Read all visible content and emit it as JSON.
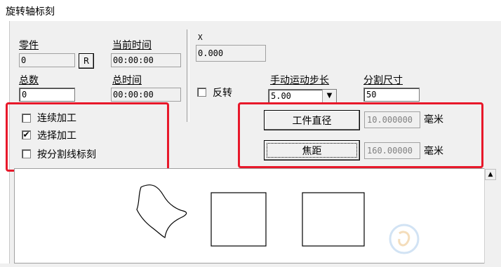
{
  "window": {
    "title": "旋转轴标刻"
  },
  "counters": {
    "part_label": "零件",
    "part_value": "0",
    "reset_label": "R",
    "current_time_label": "当前时间",
    "current_time_value": "00:00:00",
    "total_label": "总数",
    "total_value": "0",
    "total_time_label": "总时间",
    "total_time_value": "00:00:00"
  },
  "axis": {
    "x_label": "X",
    "x_value": "0.000",
    "reverse_label": "反转",
    "reverse_checked": false,
    "step_label": "手动运动步长",
    "step_value": "5.00",
    "split_label": "分割尺寸",
    "split_value": "50"
  },
  "mode": {
    "continuous_label": "连续加工",
    "continuous_checked": false,
    "select_label": "选择加工",
    "select_checked": true,
    "split_mark_label": "按分割线标刻",
    "split_mark_checked": false
  },
  "dims": {
    "diameter_button": "工件直径",
    "diameter_value": "10.000000",
    "diameter_unit": "毫米",
    "focus_button": "焦距",
    "focus_value": "160.00000",
    "focus_unit": "毫米"
  },
  "highlight_color": "#e8182a",
  "preview": {
    "shapes": [
      "freeform-curve",
      "square",
      "rectangle"
    ]
  },
  "icons": {
    "check": "✔",
    "dropdown": "▼",
    "scroll_up": "▲"
  }
}
